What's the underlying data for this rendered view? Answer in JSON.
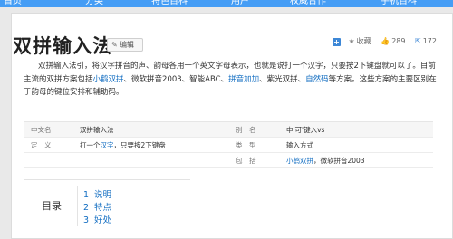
{
  "topnav": {
    "items": [
      "首页",
      "分类",
      "特色百科",
      "用户",
      "权威合作",
      "手机百科"
    ]
  },
  "article": {
    "title": "双拼输入法",
    "edit_label": "编辑",
    "actions": {
      "add": "+",
      "favorite": "收藏",
      "like_count": "289",
      "share_count": "172"
    },
    "summary": {
      "part1": "双拼输入法引，将汉字拼音的声、韵母各用一个英文字母表示，也就是说打一个汉字，只要按2下键盘就可以了。目前主流的双拼方案包括",
      "link1": "小鹤双拼",
      "part2": "、微软拼音2003、智能ABC、",
      "link2": "拼音加加",
      "part3": "、紫光双拼、",
      "link3": "自然码",
      "part4": "等方案。这些方案的主要区别在于韵母的键位安排和辅助码。"
    }
  },
  "infobox": {
    "rows": [
      {
        "k1": "中文名",
        "v1": "双拼输入法",
        "k2": "别　名",
        "v2": "中'可'键入vs"
      },
      {
        "k1": "定　义",
        "v1_pre": "打一个",
        "v1_link": "汉字",
        "v1_post": "，只要按2下键盘",
        "k2": "类　型",
        "v2": "输入方式"
      },
      {
        "k1": "",
        "v1": "",
        "k2": "包　括",
        "v2_link": "小鹤双拼",
        "v2_post": "，微软拼音2003"
      }
    ]
  },
  "toc": {
    "title": "目录",
    "items": [
      {
        "num": "1",
        "label": "说明"
      },
      {
        "num": "2",
        "label": "特点"
      },
      {
        "num": "3",
        "label": "好处"
      }
    ]
  },
  "icons": {
    "add": "plus-icon",
    "favorite": "star-icon",
    "like": "thumbs-up-icon",
    "share": "share-icon",
    "edit": "pencil-icon"
  },
  "colors": {
    "nav": "#459df5",
    "link": "#136ec2",
    "accent": "#3d87d6"
  }
}
